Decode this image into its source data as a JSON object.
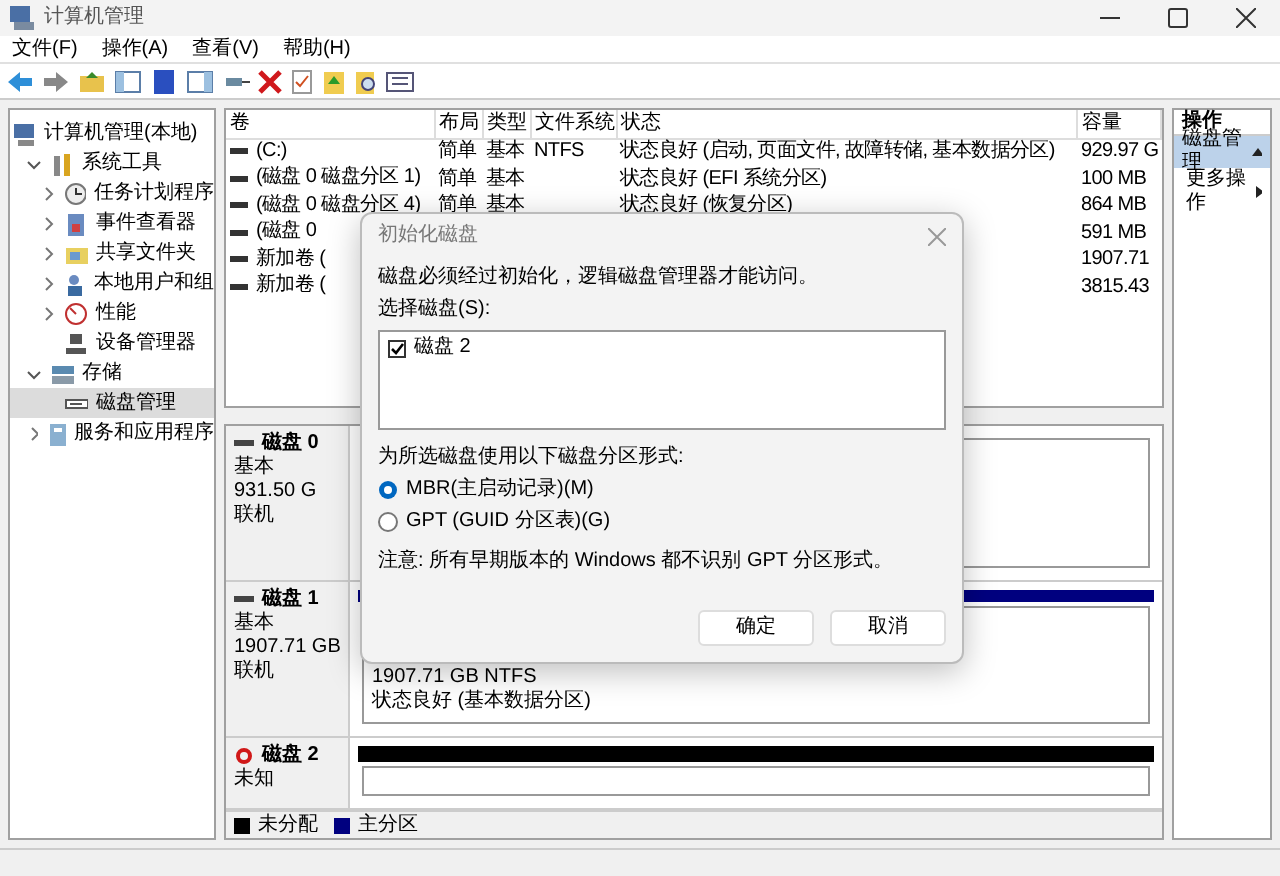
{
  "window": {
    "title": "计算机管理"
  },
  "menu": [
    "文件(F)",
    "操作(A)",
    "查看(V)",
    "帮助(H)"
  ],
  "tree": [
    {
      "label": "计算机管理(本地)",
      "kind": "computer",
      "selected": false,
      "children": [
        {
          "label": "系统工具",
          "kind": "tools",
          "expanded": true,
          "selected": false,
          "children": [
            {
              "label": "任务计划程序",
              "kind": "clock",
              "expanded": false,
              "selected": false
            },
            {
              "label": "事件查看器",
              "kind": "log",
              "expanded": false,
              "selected": false
            },
            {
              "label": "共享文件夹",
              "kind": "folder",
              "expanded": false,
              "selected": false
            },
            {
              "label": "本地用户和组",
              "kind": "users",
              "expanded": false,
              "selected": false
            },
            {
              "label": "性能",
              "kind": "gauge",
              "expanded": false,
              "selected": false
            },
            {
              "label": "设备管理器",
              "kind": "device",
              "selected": false
            }
          ]
        },
        {
          "label": "存储",
          "kind": "storage",
          "expanded": true,
          "selected": false,
          "children": [
            {
              "label": "磁盘管理",
              "kind": "disk",
              "selected": true
            }
          ]
        },
        {
          "label": "服务和应用程序",
          "kind": "services",
          "expanded": false,
          "selected": false
        }
      ]
    }
  ],
  "volumes": {
    "columns": [
      "卷",
      "布局",
      "类型",
      "文件系统",
      "状态",
      "容量"
    ],
    "rows": [
      {
        "volume": "(C:)",
        "layout": "简单",
        "type": "基本",
        "fs": "NTFS",
        "status": "状态良好 (启动, 页面文件, 故障转储, 基本数据分区)",
        "capacity": "929.97 G"
      },
      {
        "volume": "(磁盘 0 磁盘分区 1)",
        "layout": "简单",
        "type": "基本",
        "status": "状态良好 (EFI 系统分区)",
        "capacity": "100 MB"
      },
      {
        "volume": "(磁盘 0 磁盘分区 4)",
        "layout": "简单",
        "type": "基本",
        "status": "状态良好 (恢复分区)",
        "capacity": "864 MB"
      },
      {
        "volume": "(磁盘 0",
        "capacity": "591 MB"
      },
      {
        "volume": "新加卷 (",
        "capacity": "1907.71"
      },
      {
        "volume": "新加卷 (",
        "capacity": "3815.43"
      }
    ]
  },
  "actions": {
    "title": "操作",
    "items": [
      {
        "label": "磁盘管理",
        "kind": "header"
      },
      {
        "label": "更多操作",
        "kind": "item"
      }
    ]
  },
  "disks": [
    {
      "name": "磁盘 0",
      "kind": "basic",
      "info": [
        "基本",
        "931.50 G",
        "联机"
      ],
      "partition": {
        "kind": "covered"
      }
    },
    {
      "name": "磁盘 1",
      "kind": "basic",
      "info": [
        "基本",
        "1907.71 GB",
        "联机"
      ],
      "partition": {
        "kind": "primary",
        "lines": [
          "1907.71 GB NTFS",
          "状态良好 (基本数据分区)"
        ]
      }
    },
    {
      "name": "磁盘 2",
      "kind": "unknown",
      "info": [
        "未知"
      ],
      "partition": {
        "kind": "unallocated"
      }
    }
  ],
  "legend": [
    {
      "label": "未分配",
      "color": "#000000"
    },
    {
      "label": "主分区",
      "color": "#00007f"
    }
  ],
  "dialog": {
    "title": "初始化磁盘",
    "message": "磁盘必须经过初始化，逻辑磁盘管理器才能访问。",
    "list_label": "选择磁盘(S):",
    "disks": [
      {
        "label": "磁盘 2",
        "checked": true
      }
    ],
    "style_label": "为所选磁盘使用以下磁盘分区形式:",
    "options": [
      {
        "label": "MBR(主启动记录)(M)",
        "selected": true
      },
      {
        "label": "GPT (GUID 分区表)(G)",
        "selected": false
      }
    ],
    "note": "注意: 所有早期版本的 Windows 都不识别 GPT 分区形式。",
    "buttons": [
      "确定",
      "取消"
    ]
  }
}
